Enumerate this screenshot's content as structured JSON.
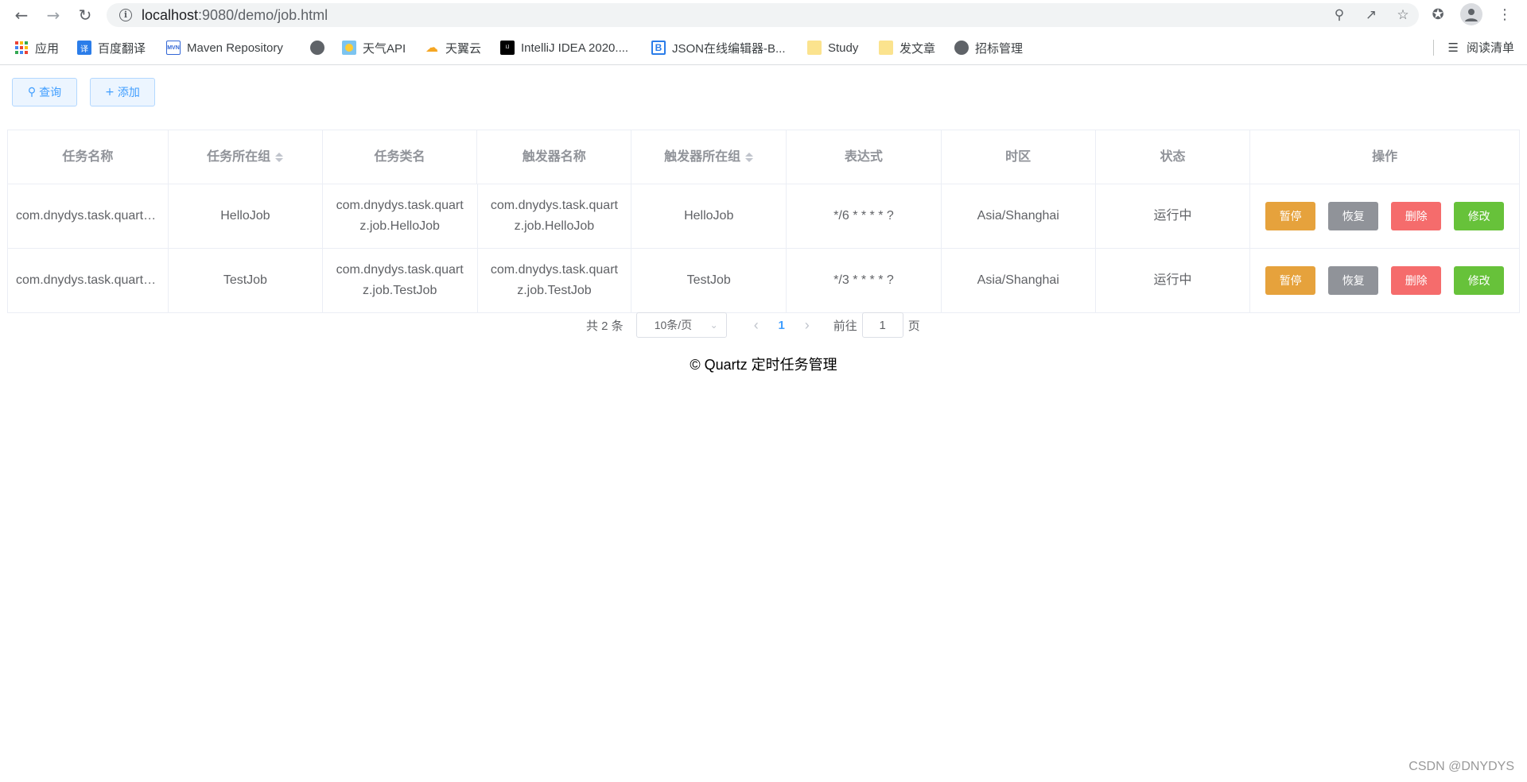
{
  "browser": {
    "url_host": "localhost",
    "url_rest": ":9080/demo/job.html",
    "bookmarks": [
      {
        "label": "应用",
        "icon": "apps-grid-icon"
      },
      {
        "label": "百度翻译",
        "icon": "baidu-translate-icon"
      },
      {
        "label": "Maven Repository",
        "icon": "maven-icon"
      },
      {
        "label": "",
        "icon": "globe-icon"
      },
      {
        "label": "天气API",
        "icon": "weather-icon"
      },
      {
        "label": "天翼云",
        "icon": "cloud-icon"
      },
      {
        "label": "IntelliJ IDEA 2020....",
        "icon": "intellij-icon"
      },
      {
        "label": "JSON在线编辑器-B...",
        "icon": "json-editor-icon"
      },
      {
        "label": "Study",
        "icon": "folder-icon"
      },
      {
        "label": "发文章",
        "icon": "folder-icon"
      },
      {
        "label": "招标管理",
        "icon": "globe-icon"
      }
    ],
    "reading_list": "阅读清单"
  },
  "toolbar": {
    "query_label": "查询",
    "add_label": "添加"
  },
  "table": {
    "headers": [
      "任务名称",
      "任务所在组",
      "任务类名",
      "触发器名称",
      "触发器所在组",
      "表达式",
      "时区",
      "状态",
      "操作"
    ],
    "rows": [
      {
        "job_name": "com.dnydys.task.quartz.job.HelloJob",
        "job_group": "HelloJob",
        "job_class_1": "com.dnydys.task.quart",
        "job_class_2": "z.job.HelloJob",
        "trigger_name_1": "com.dnydys.task.quart",
        "trigger_name_2": "z.job.HelloJob",
        "trigger_group": "HelloJob",
        "cron": "*/6 * * * * ?",
        "timezone": "Asia/Shanghai",
        "status": "运行中"
      },
      {
        "job_name": "com.dnydys.task.quartz.job.TestJob",
        "job_group": "TestJob",
        "job_class_1": "com.dnydys.task.quart",
        "job_class_2": "z.job.TestJob",
        "trigger_name_1": "com.dnydys.task.quart",
        "trigger_name_2": "z.job.TestJob",
        "trigger_group": "TestJob",
        "cron": "*/3 * * * * ?",
        "timezone": "Asia/Shanghai",
        "status": "运行中"
      }
    ],
    "actions": {
      "pause": "暂停",
      "resume": "恢复",
      "delete": "删除",
      "edit": "修改"
    }
  },
  "pagination": {
    "total": "共 2 条",
    "page_size": "10条/页",
    "current_page": "1",
    "goto_prefix": "前往",
    "goto_value": "1",
    "goto_suffix": "页"
  },
  "footer": "© Quartz 定时任务管理",
  "watermark": "CSDN @DNYDYS",
  "colors": {
    "primary": "#409eff",
    "warning": "#e6a23c",
    "info": "#909399",
    "danger": "#f56c6c",
    "success": "#67c23a"
  }
}
